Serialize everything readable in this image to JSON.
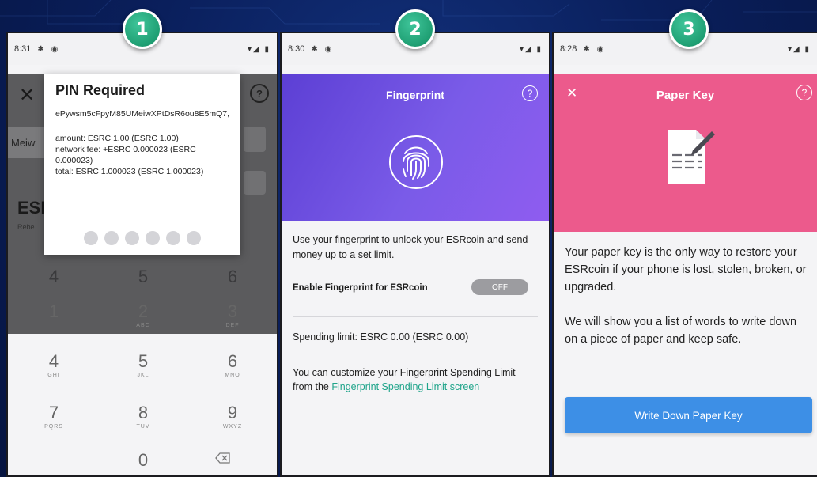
{
  "badges": [
    "1",
    "2",
    "3"
  ],
  "status": {
    "p1_time": "8:31",
    "p2_time": "8:30",
    "p3_time": "8:28"
  },
  "screen1": {
    "dialog_title": "PIN Required",
    "address": "ePywsm5cFpyM85UMeiwXPtDsR6ou8E5mQ7,",
    "amount": "amount: ESRC 1.00 (ESRC 1.00)",
    "network_fee": "network fee: +ESRC 0.000023 (ESRC 0.000023)",
    "total": "total: ESRC 1.000023 (ESRC 1.000023)",
    "underlay_address_fragment": "Meiw",
    "underlay_currency": "ESR",
    "underlay_sub": "Rebe",
    "keypad": [
      {
        "num": "4",
        "letters": ""
      },
      {
        "num": "5",
        "letters": ""
      },
      {
        "num": "6",
        "letters": ""
      },
      {
        "num": "1",
        "letters": ""
      },
      {
        "num": "2",
        "letters": "ABC"
      },
      {
        "num": "3",
        "letters": "DEF"
      },
      {
        "num": "4",
        "letters": "GHI"
      },
      {
        "num": "5",
        "letters": "JKL"
      },
      {
        "num": "6",
        "letters": "MNO"
      },
      {
        "num": "7",
        "letters": "PQRS"
      },
      {
        "num": "8",
        "letters": "TUV"
      },
      {
        "num": "9",
        "letters": "WXYZ"
      },
      {
        "num": "0",
        "letters": ""
      }
    ],
    "pin_length": 6
  },
  "screen2": {
    "title": "Fingerprint",
    "description": "Use your fingerprint to unlock your ESRcoin and send money up to a set limit.",
    "enable_label": "Enable Fingerprint for ESRcoin",
    "toggle_state": "OFF",
    "spending_limit": "Spending limit: ESRC 0.00 (ESRC 0.00)",
    "customize_text": "You can customize your Fingerprint Spending Limit from the ",
    "customize_link": "Fingerprint Spending Limit screen",
    "header_gradient_start": "#5c3fd4",
    "header_gradient_end": "#8f5cf0"
  },
  "screen3": {
    "title": "Paper Key",
    "paragraph1": "Your paper key is the only way to restore your ESRcoin if your phone is lost, stolen, broken, or upgraded.",
    "paragraph2": "We will show you a list of words to write down on a piece of paper and keep safe.",
    "button": "Write Down Paper Key",
    "header_color": "#ec5a8c",
    "button_color": "#3d8fe6"
  }
}
